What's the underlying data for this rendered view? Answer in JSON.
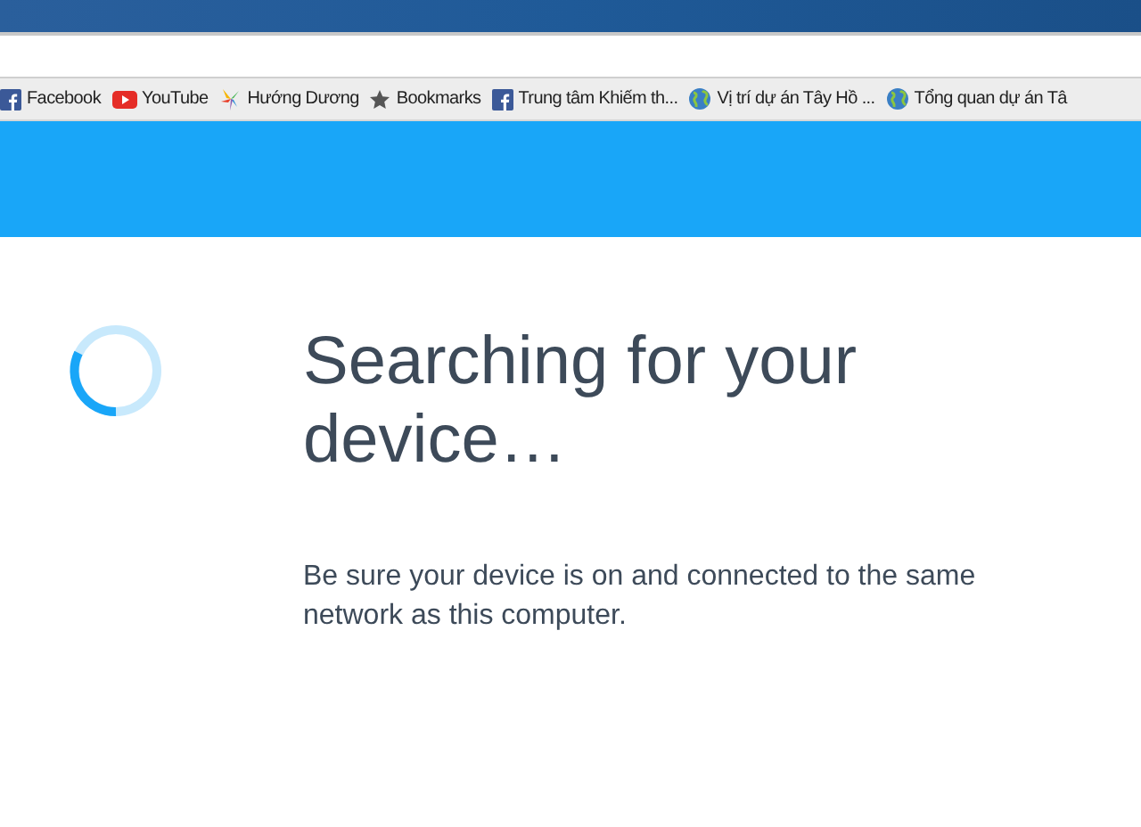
{
  "bookmarks": [
    {
      "kind": "facebook",
      "label": "Facebook"
    },
    {
      "kind": "youtube",
      "label": "YouTube"
    },
    {
      "kind": "flower",
      "label": "Hướng Dương"
    },
    {
      "kind": "star",
      "label": "Bookmarks"
    },
    {
      "kind": "facebook",
      "label": "Trung tâm Khiếm th..."
    },
    {
      "kind": "globe",
      "label": "Vị trí dự án Tây Hồ ..."
    },
    {
      "kind": "globe",
      "label": "Tổng quan dự án Tâ"
    }
  ],
  "content": {
    "title": "Searching for your device…",
    "message": "Be sure your device is on and connected to the same network as this computer."
  }
}
